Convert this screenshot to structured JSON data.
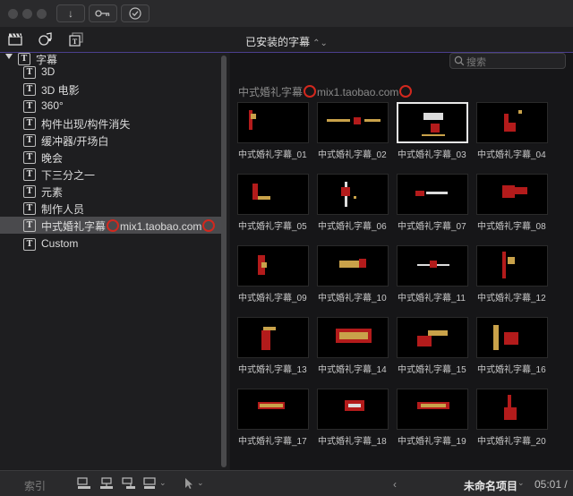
{
  "window": {
    "traffic_lights": [
      "close",
      "minimize",
      "zoom"
    ]
  },
  "titlebar_buttons": [
    {
      "name": "import-button",
      "icon": "down-arrow-icon",
      "glyph": "↓"
    },
    {
      "name": "keywords-button",
      "icon": "key-icon",
      "glyph": "⚿"
    },
    {
      "name": "background-tasks-button",
      "icon": "checkmark-circle-icon",
      "glyph": "✓"
    }
  ],
  "browser": {
    "tabs": [
      {
        "name": "tab-libraries",
        "icon": "clapper-icon"
      },
      {
        "name": "tab-photos-audio",
        "icon": "photos-audio-icon"
      },
      {
        "name": "tab-titles-generators",
        "icon": "titles-generators-icon"
      }
    ],
    "menu_title": "已安装的字幕",
    "menu_chevron": "⌃"
  },
  "sidebar": {
    "root": {
      "label": "字幕",
      "expanded": true
    },
    "items": [
      {
        "label": "3D"
      },
      {
        "label": "3D 电影"
      },
      {
        "label": "360°"
      },
      {
        "label": "构件出现/构件消失"
      },
      {
        "label": "缓冲器/开场白"
      },
      {
        "label": "晚会"
      },
      {
        "label": "下三分之一"
      },
      {
        "label": "元素"
      },
      {
        "label": "制作人员"
      },
      {
        "label_a": "中式婚礼字幕",
        "label_b": "mix1.taobao.com",
        "selected": true
      },
      {
        "label": "Custom"
      }
    ]
  },
  "search": {
    "placeholder": "搜索"
  },
  "section": {
    "title_a": "中式婚礼字幕",
    "title_b": "mix1.taobao.com"
  },
  "tiles": [
    {
      "label": "中式婚礼字幕_01"
    },
    {
      "label": "中式婚礼字幕_02"
    },
    {
      "label": "中式婚礼字幕_03",
      "selected": true
    },
    {
      "label": "中式婚礼字幕_04"
    },
    {
      "label": "中式婚礼字幕_05"
    },
    {
      "label": "中式婚礼字幕_06"
    },
    {
      "label": "中式婚礼字幕_07"
    },
    {
      "label": "中式婚礼字幕_08"
    },
    {
      "label": "中式婚礼字幕_09"
    },
    {
      "label": "中式婚礼字幕_10"
    },
    {
      "label": "中式婚礼字幕_11"
    },
    {
      "label": "中式婚礼字幕_12"
    },
    {
      "label": "中式婚礼字幕_13"
    },
    {
      "label": "中式婚礼字幕_14"
    },
    {
      "label": "中式婚礼字幕_15"
    },
    {
      "label": "中式婚礼字幕_16"
    },
    {
      "label": "中式婚礼字幕_17"
    },
    {
      "label": "中式婚礼字幕_18"
    },
    {
      "label": "中式婚礼字幕_19"
    },
    {
      "label": "中式婚礼字幕_20"
    }
  ],
  "bottombar": {
    "index_label": "索引",
    "project_name": "未命名项目",
    "timecode": "05:01 /"
  },
  "colors": {
    "accent_line": "#4b3f8e",
    "highlight_ring": "#d2281e",
    "selection": "#4a4a4d"
  }
}
